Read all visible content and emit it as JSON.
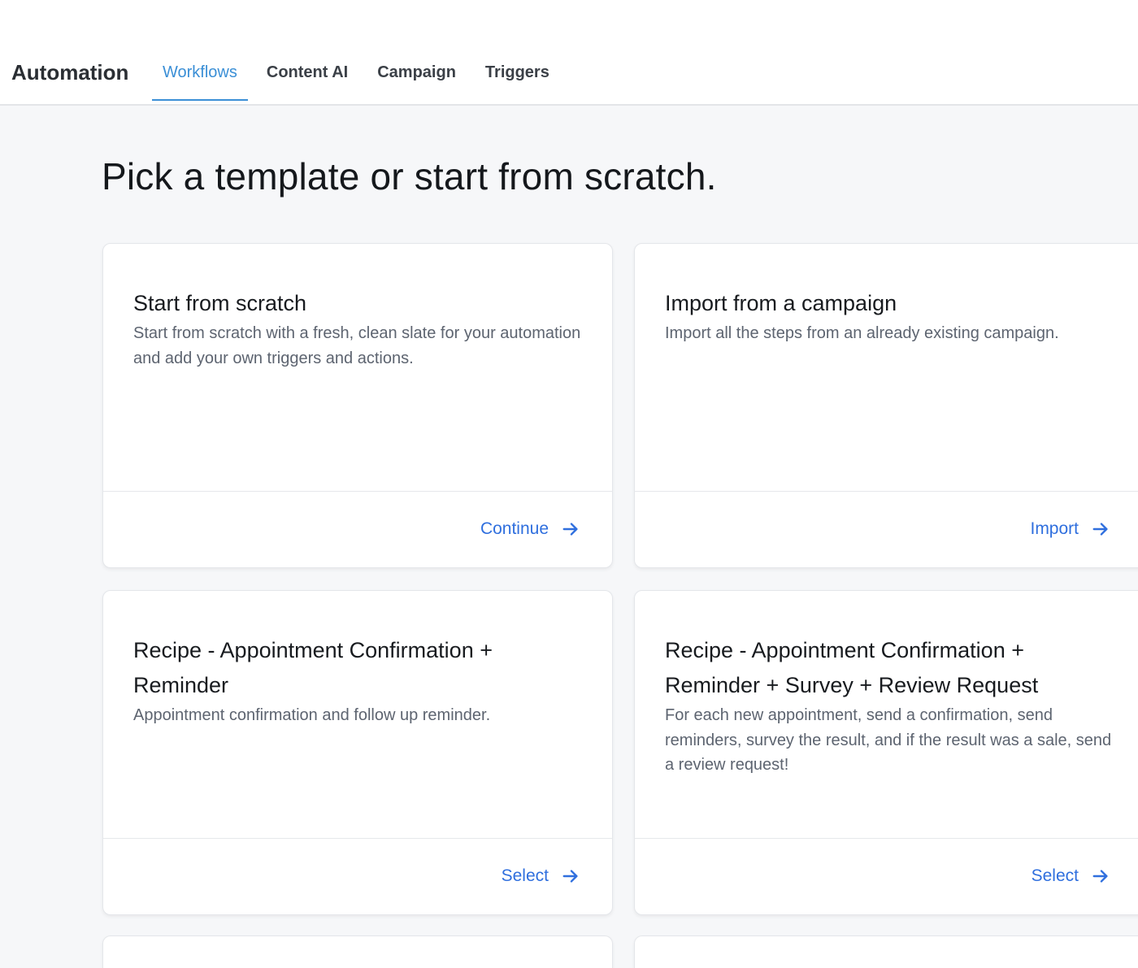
{
  "app": {
    "title": "Automation"
  },
  "tabs": [
    {
      "label": "Workflows",
      "active": true
    },
    {
      "label": "Content AI",
      "active": false
    },
    {
      "label": "Campaign",
      "active": false
    },
    {
      "label": "Triggers",
      "active": false
    }
  ],
  "page": {
    "heading": "Pick a template or start from scratch."
  },
  "cards": [
    {
      "title": "Start from scratch",
      "description": "Start from scratch with a fresh, clean slate for your automation and add your own triggers and actions.",
      "action": "Continue",
      "action_icon": "arrow-right-icon"
    },
    {
      "title": "Import from a campaign",
      "description": "Import all the steps from an already existing campaign.",
      "action": "Import",
      "action_icon": "arrow-right-icon"
    },
    {
      "title": "Recipe - Appointment Confirmation + Reminder",
      "description": "Appointment confirmation and follow up reminder.",
      "action": "Select",
      "action_icon": "arrow-right-icon"
    },
    {
      "title": "Recipe - Appointment Confirmation + Reminder + Survey + Review Request",
      "description": "For each new appointment, send a confirmation, send reminders, survey the result, and if the result was a sale, send a review request!",
      "action": "Select",
      "action_icon": "arrow-right-icon"
    }
  ],
  "colors": {
    "accent": "#3b8fd6",
    "action": "#2f6fde",
    "background": "#f6f7f9",
    "card": "#ffffff"
  }
}
